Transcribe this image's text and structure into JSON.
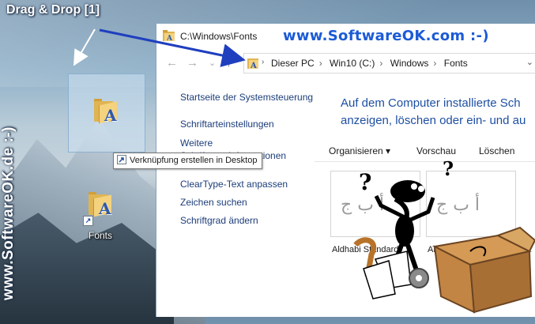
{
  "desktop": {
    "drag_label": "Drag & Drop [1]",
    "watermark_side": "www.SoftwareOK.de :-)",
    "shortcut_label": "Fonts",
    "tooltip": "Verknüpfung erstellen in Desktop"
  },
  "window": {
    "title": "C:\\Windows\\Fonts",
    "brand": "www.SoftwareOK.com :-)",
    "breadcrumb": [
      "Dieser PC",
      "Win10 (C:)",
      "Windows",
      "Fonts"
    ],
    "nav": {
      "back": "←",
      "forward": "→",
      "recent": "⌄",
      "up": "↑"
    }
  },
  "left_pane": {
    "links": [
      "Startseite der Systemsteuerung",
      "Schriftarteinstellungen",
      "Weitere Schriftarteninformationen",
      "ClearType-Text anpassen",
      "Zeichen suchen",
      "Schriftgrad ändern"
    ]
  },
  "main": {
    "heading_line1": "Auf dem Computer installierte Sch",
    "heading_line2": "anzeigen, löschen oder ein- und au",
    "commands": [
      "Organisieren ▾",
      "Vorschau",
      "Löschen"
    ],
    "fonts": [
      {
        "preview": "أ ب ج",
        "name": "Aldhabi Standard"
      },
      {
        "preview": "أ ب ج",
        "name": "And"
      }
    ]
  },
  "colors": {
    "link": "#1c3d7a",
    "heading": "#1e4fa3",
    "brand": "#1c5bd6",
    "drag_arrow": "#1f3fbf"
  }
}
